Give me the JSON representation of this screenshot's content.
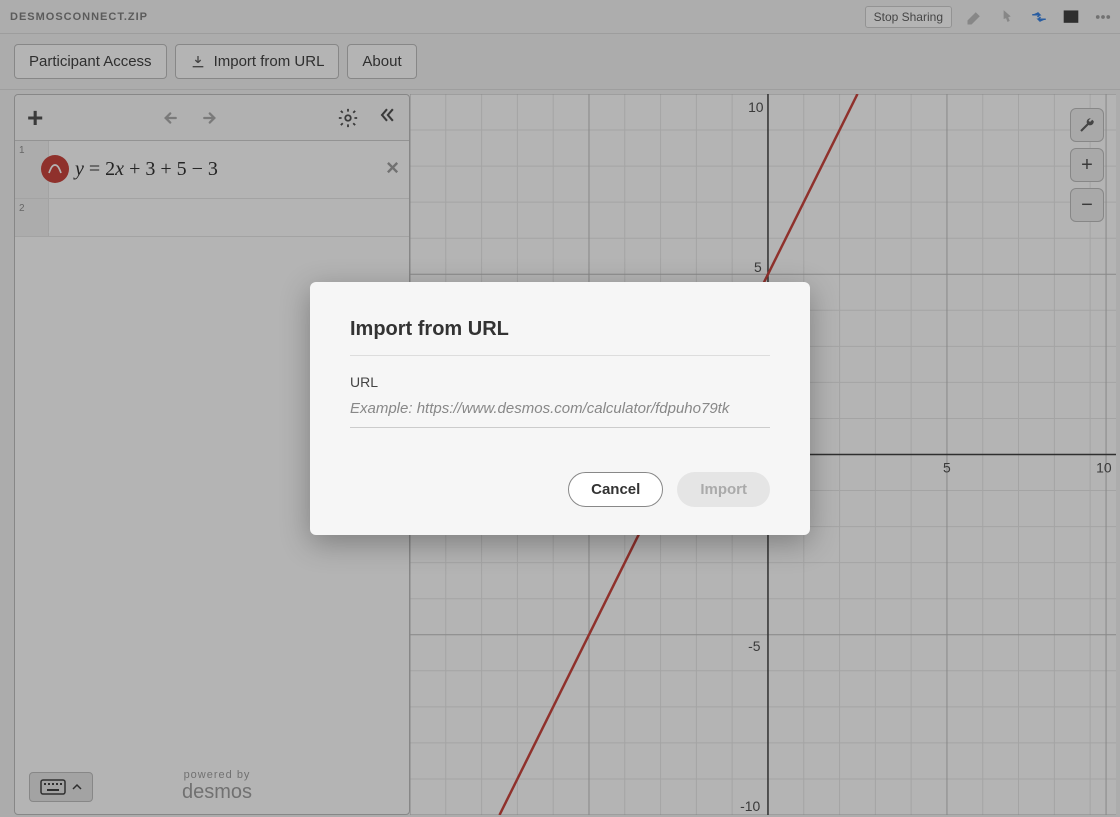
{
  "titlebar": {
    "title": "DESMOSCONNECT.ZIP",
    "stop_sharing": "Stop Sharing"
  },
  "toolbar": {
    "participant_access": "Participant Access",
    "import_from_url": "Import from URL",
    "about": "About"
  },
  "sidebar": {
    "expressions": [
      {
        "index": "1",
        "content": "y = 2x + 3 + 5 − 3"
      },
      {
        "index": "2",
        "content": ""
      }
    ],
    "powered_label": "powered by",
    "powered_brand": "desmos"
  },
  "graph": {
    "axis_values": {
      "y_top": "10",
      "y_mid_pos": "5",
      "y_mid_neg": "-5",
      "y_bottom": "-10",
      "x_pos": "5",
      "x_neg": "",
      "x_far": "10"
    }
  },
  "modal": {
    "title": "Import from URL",
    "field_label": "URL",
    "placeholder": "Example: https://www.desmos.com/calculator/fdpuho79tk",
    "cancel": "Cancel",
    "import": "Import"
  },
  "chart_data": {
    "type": "line",
    "title": "",
    "xlabel": "",
    "ylabel": "",
    "xlim": [
      -10,
      10
    ],
    "ylim": [
      -10,
      10
    ],
    "series": [
      {
        "name": "y = 2x + 5",
        "equation": "y = 2x + 3 + 5 - 3",
        "x": [
          -10,
          10
        ],
        "y": [
          -15,
          25
        ]
      }
    ]
  }
}
